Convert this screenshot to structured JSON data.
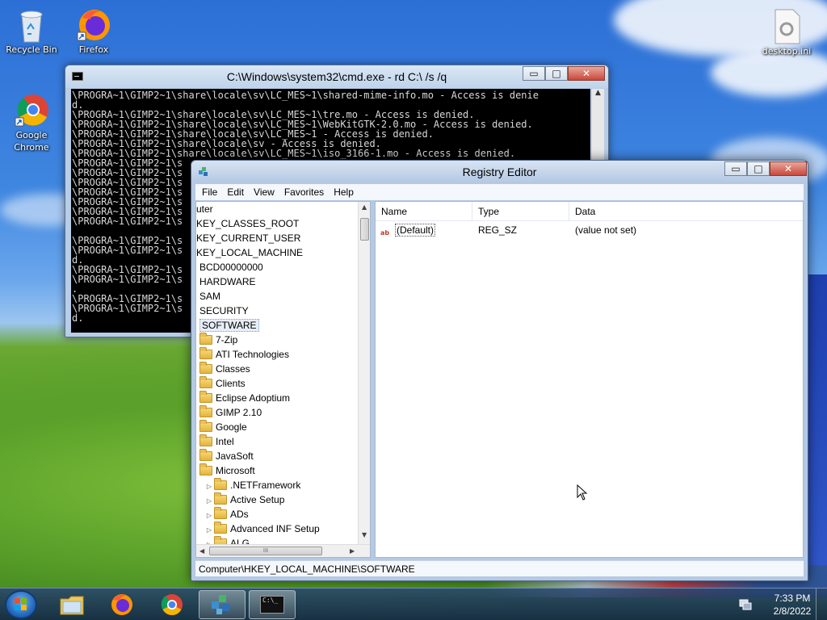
{
  "desktop": {
    "icons": [
      {
        "label": "Recycle Bin"
      },
      {
        "label": "Firefox"
      },
      {
        "label": "Google Chrome"
      },
      {
        "label": "desktop.ini"
      }
    ]
  },
  "cmd": {
    "title": "C:\\Windows\\system32\\cmd.exe - rd  C:\\ /s /q",
    "lines": [
      "\\PROGRA~1\\GIMP2~1\\share\\locale\\sv\\LC_MES~1\\shared-mime-info.mo - Access is denie",
      "d.",
      "\\PROGRA~1\\GIMP2~1\\share\\locale\\sv\\LC_MES~1\\tre.mo - Access is denied.",
      "\\PROGRA~1\\GIMP2~1\\share\\locale\\sv\\LC_MES~1\\WebKitGTK-2.0.mo - Access is denied.",
      "\\PROGRA~1\\GIMP2~1\\share\\locale\\sv\\LC_MES~1 - Access is denied.",
      "\\PROGRA~1\\GIMP2~1\\share\\locale\\sv - Access is denied.",
      "\\PROGRA~1\\GIMP2~1\\share\\locale\\sv\\LC_MES~1\\iso_3166-1.mo - Access is denied.",
      "\\PROGRA~1\\GIMP2~1\\s",
      "\\PROGRA~1\\GIMP2~1\\s",
      "\\PROGRA~1\\GIMP2~1\\s",
      "\\PROGRA~1\\GIMP2~1\\s",
      "\\PROGRA~1\\GIMP2~1\\s",
      "\\PROGRA~1\\GIMP2~1\\s",
      "\\PROGRA~1\\GIMP2~1\\s",
      "",
      "\\PROGRA~1\\GIMP2~1\\s",
      "\\PROGRA~1\\GIMP2~1\\s",
      "d.",
      "\\PROGRA~1\\GIMP2~1\\s",
      "\\PROGRA~1\\GIMP2~1\\s",
      ".",
      "\\PROGRA~1\\GIMP2~1\\s",
      "\\PROGRA~1\\GIMP2~1\\s",
      "d."
    ],
    "buttons": {
      "minimize": "▭",
      "maximize": "□",
      "close": "✕"
    }
  },
  "regedit": {
    "title": "Registry Editor",
    "menu": [
      "File",
      "Edit",
      "View",
      "Favorites",
      "Help"
    ],
    "tree": [
      {
        "label": "uter",
        "folder": false,
        "indent": 0
      },
      {
        "label": "KEY_CLASSES_ROOT",
        "folder": false,
        "indent": 0
      },
      {
        "label": "KEY_CURRENT_USER",
        "folder": false,
        "indent": 0
      },
      {
        "label": "KEY_LOCAL_MACHINE",
        "folder": false,
        "indent": 0
      },
      {
        "label": "BCD00000000",
        "folder": false,
        "indent": 1
      },
      {
        "label": "HARDWARE",
        "folder": false,
        "indent": 1
      },
      {
        "label": "SAM",
        "folder": false,
        "indent": 1
      },
      {
        "label": "SECURITY",
        "folder": false,
        "indent": 1
      },
      {
        "label": "SOFTWARE",
        "folder": false,
        "indent": 1,
        "selected": true
      },
      {
        "label": "7-Zip",
        "folder": true,
        "indent": 1
      },
      {
        "label": "ATI Technologies",
        "folder": true,
        "indent": 1
      },
      {
        "label": "Classes",
        "folder": true,
        "indent": 1
      },
      {
        "label": "Clients",
        "folder": true,
        "indent": 1
      },
      {
        "label": "Eclipse Adoptium",
        "folder": true,
        "indent": 1
      },
      {
        "label": "GIMP 2.10",
        "folder": true,
        "indent": 1
      },
      {
        "label": "Google",
        "folder": true,
        "indent": 1
      },
      {
        "label": "Intel",
        "folder": true,
        "indent": 1
      },
      {
        "label": "JavaSoft",
        "folder": true,
        "indent": 1
      },
      {
        "label": "Microsoft",
        "folder": true,
        "indent": 1
      },
      {
        "label": ".NETFramework",
        "folder": true,
        "indent": 2,
        "arrow": true
      },
      {
        "label": "Active Setup",
        "folder": true,
        "indent": 2,
        "arrow": true
      },
      {
        "label": "ADs",
        "folder": true,
        "indent": 2,
        "arrow": true
      },
      {
        "label": "Advanced INF Setup",
        "folder": true,
        "indent": 2,
        "arrow": true
      },
      {
        "label": "ALG",
        "folder": true,
        "indent": 2,
        "arrow": true
      }
    ],
    "columns": [
      "Name",
      "Type",
      "Data"
    ],
    "values": [
      {
        "name": "(Default)",
        "type": "REG_SZ",
        "data": "(value not set)",
        "icon": "ab"
      }
    ],
    "status": "Computer\\HKEY_LOCAL_MACHINE\\SOFTWARE",
    "hscroll_grip": "III"
  },
  "taskbar": {
    "time": "7:33 PM",
    "date": "2/8/2022",
    "cmd_glyph": "C:\\_"
  }
}
